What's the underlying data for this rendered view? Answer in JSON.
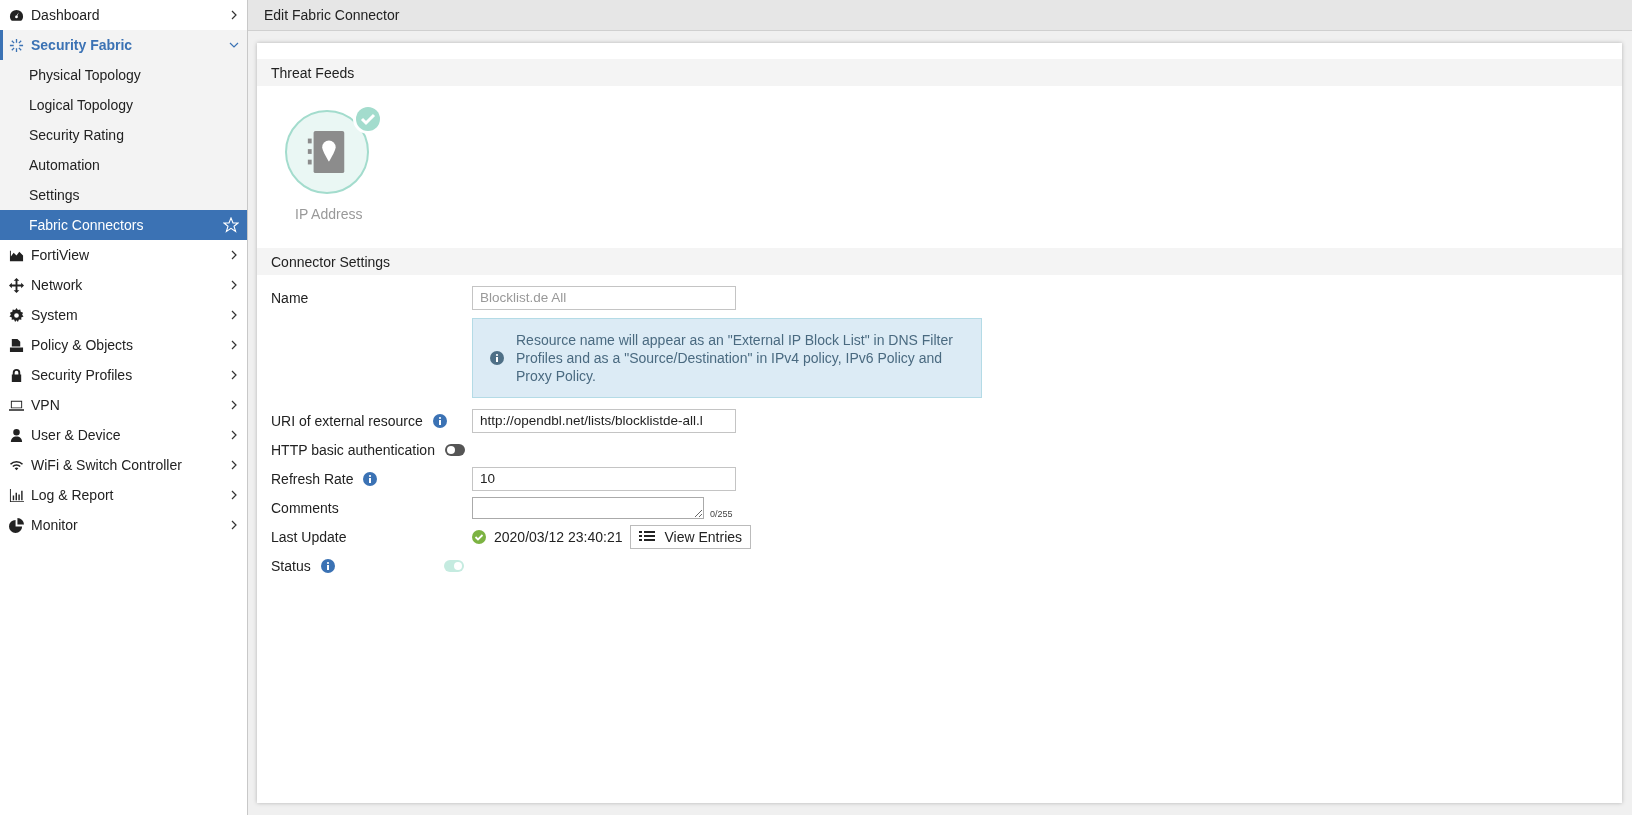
{
  "sidebar": {
    "items": [
      {
        "label": "Dashboard",
        "expanded": false
      },
      {
        "label": "Security Fabric",
        "expanded": true,
        "children": [
          {
            "label": "Physical Topology",
            "selected": false
          },
          {
            "label": "Logical Topology",
            "selected": false
          },
          {
            "label": "Security Rating",
            "selected": false
          },
          {
            "label": "Automation",
            "selected": false
          },
          {
            "label": "Settings",
            "selected": false
          },
          {
            "label": "Fabric Connectors",
            "selected": true
          }
        ]
      },
      {
        "label": "FortiView",
        "expanded": false
      },
      {
        "label": "Network",
        "expanded": false
      },
      {
        "label": "System",
        "expanded": false
      },
      {
        "label": "Policy & Objects",
        "expanded": false
      },
      {
        "label": "Security Profiles",
        "expanded": false
      },
      {
        "label": "VPN",
        "expanded": false
      },
      {
        "label": "User & Device",
        "expanded": false
      },
      {
        "label": "WiFi & Switch Controller",
        "expanded": false
      },
      {
        "label": "Log & Report",
        "expanded": false
      },
      {
        "label": "Monitor",
        "expanded": false
      }
    ]
  },
  "header": {
    "title": "Edit Fabric Connector"
  },
  "threat_feeds": {
    "title": "Threat Feeds",
    "feeds": [
      {
        "label": "IP Address",
        "selected": true
      }
    ]
  },
  "connector_settings": {
    "title": "Connector Settings",
    "name": {
      "label": "Name",
      "value": "Blocklist.de All",
      "disabled": true
    },
    "notice": "Resource name will appear as an \"External IP Block List\" in DNS Filter Profiles and as a \"Source/Destination\" in IPv4 policy, IPv6 Policy and Proxy Policy.",
    "uri": {
      "label": "URI of external resource",
      "value": "http://opendbl.net/lists/blocklistde-all.l"
    },
    "http_auth": {
      "label": "HTTP basic authentication",
      "on": false,
      "disabled": false
    },
    "refresh_rate": {
      "label": "Refresh Rate",
      "value": "10"
    },
    "comments": {
      "label": "Comments",
      "counter": "0/255"
    },
    "last_update": {
      "label": "Last Update",
      "ok": true,
      "value": "2020/03/12 23:40:21",
      "button": "View Entries"
    },
    "status": {
      "label": "Status",
      "on": true,
      "disabled": true
    }
  }
}
